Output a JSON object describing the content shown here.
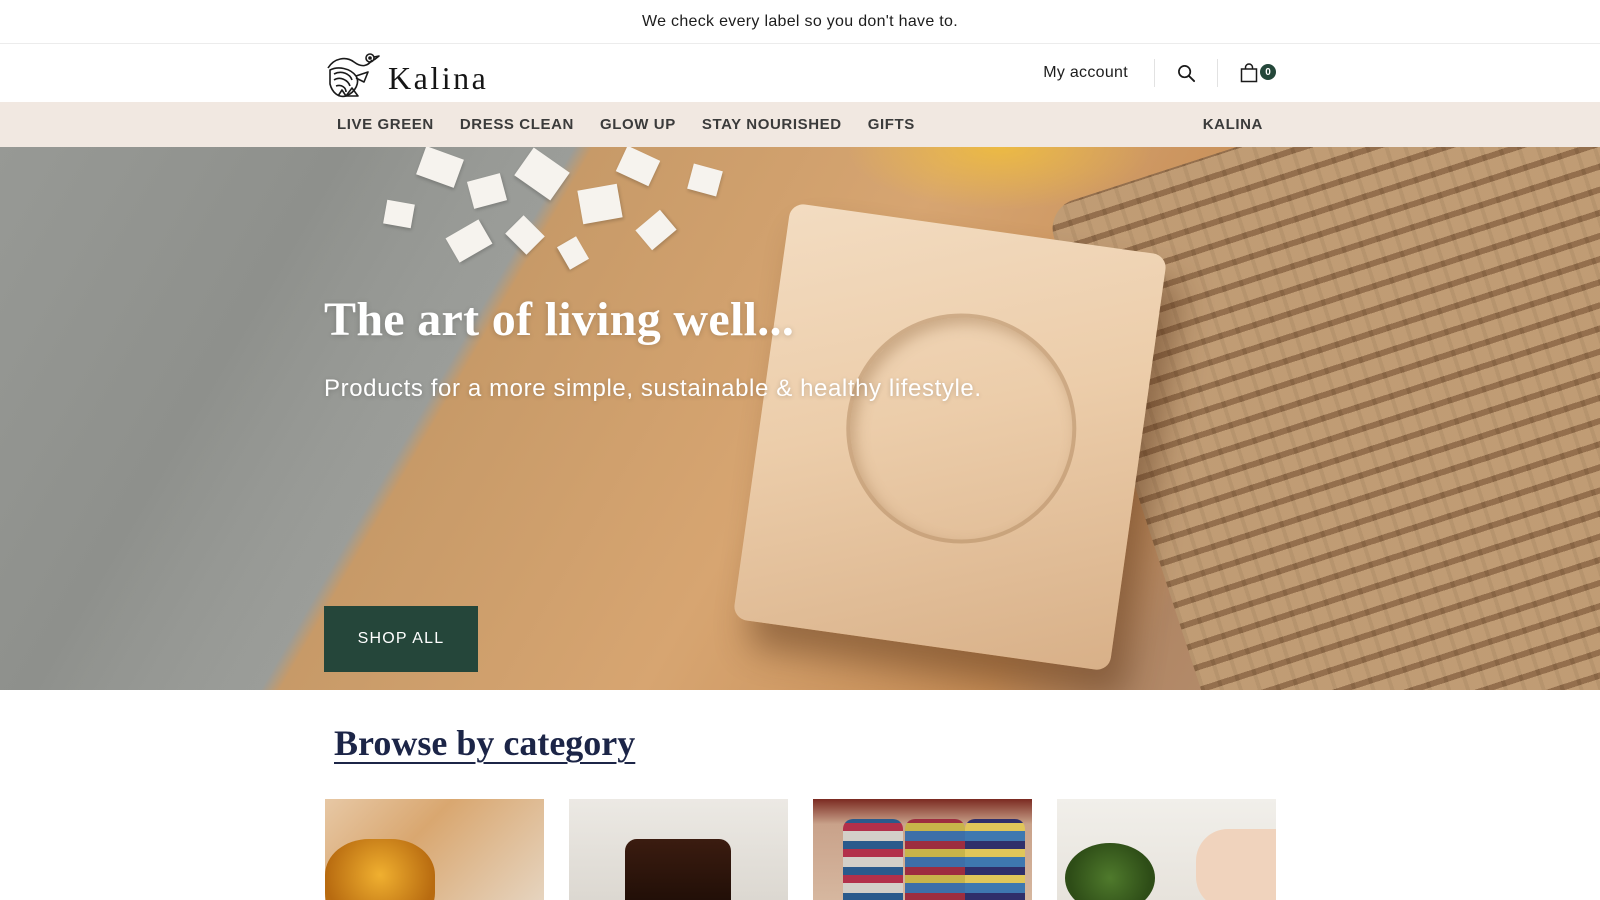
{
  "announcement": {
    "text": "We check every label so you don't have to."
  },
  "header": {
    "logo_text": "Kalina",
    "account_label": "My account",
    "cart_count": "0"
  },
  "nav": {
    "items": [
      {
        "label": "LIVE GREEN"
      },
      {
        "label": "DRESS CLEAN"
      },
      {
        "label": "GLOW UP"
      },
      {
        "label": "STAY NOURISHED"
      },
      {
        "label": "GIFTS"
      }
    ],
    "right_item": {
      "label": "KALINA"
    }
  },
  "hero": {
    "title": "The art of living well...",
    "subtitle": "Products for a more simple, sustainable & healthy lifestyle.",
    "button_label": "SHOP ALL"
  },
  "browse": {
    "title": "Browse by category"
  },
  "colors": {
    "accent": "#25463a",
    "nav_background": "#f1e8e1",
    "heading": "#1c2547"
  },
  "icons": [
    "bird-logo-icon",
    "search-icon",
    "shopping-bag-icon"
  ]
}
